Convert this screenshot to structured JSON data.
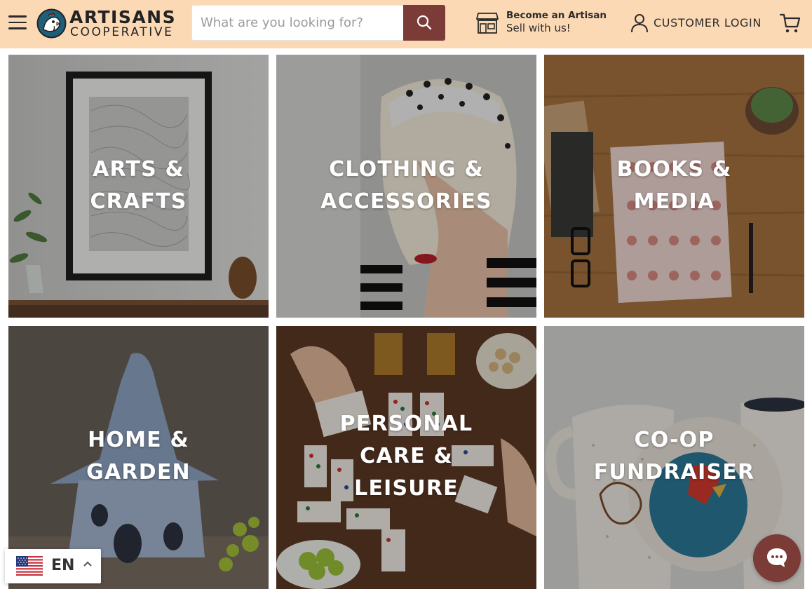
{
  "header": {
    "logo": {
      "line1": "ARTISANS",
      "line2": "COOPERATIVE"
    },
    "search": {
      "placeholder": "What are you looking for?"
    },
    "artisan_link": {
      "line1": "Become an Artisan",
      "line2": "Sell with us!"
    },
    "login_label": "CUSTOMER LOGIN",
    "icons": [
      "menu-icon",
      "search-icon",
      "shop-icon",
      "user-icon",
      "cart-icon"
    ]
  },
  "categories": [
    {
      "label": "ARTS &\nCRAFTS"
    },
    {
      "label": "CLOTHING &\nACCESSORIES"
    },
    {
      "label": "BOOKS &\nMEDIA"
    },
    {
      "label": "HOME &\nGARDEN"
    },
    {
      "label": "PERSONAL\nCARE &\nLEISURE"
    },
    {
      "label": "CO-OP\nFUNDRAISER"
    }
  ],
  "language": {
    "code": "EN",
    "flag": "us-flag-icon"
  },
  "chat": {
    "icon": "chat-icon"
  },
  "colors": {
    "header_bg": "#fcd9b5",
    "accent": "#7b3b36",
    "text": "#2b2b2b"
  }
}
